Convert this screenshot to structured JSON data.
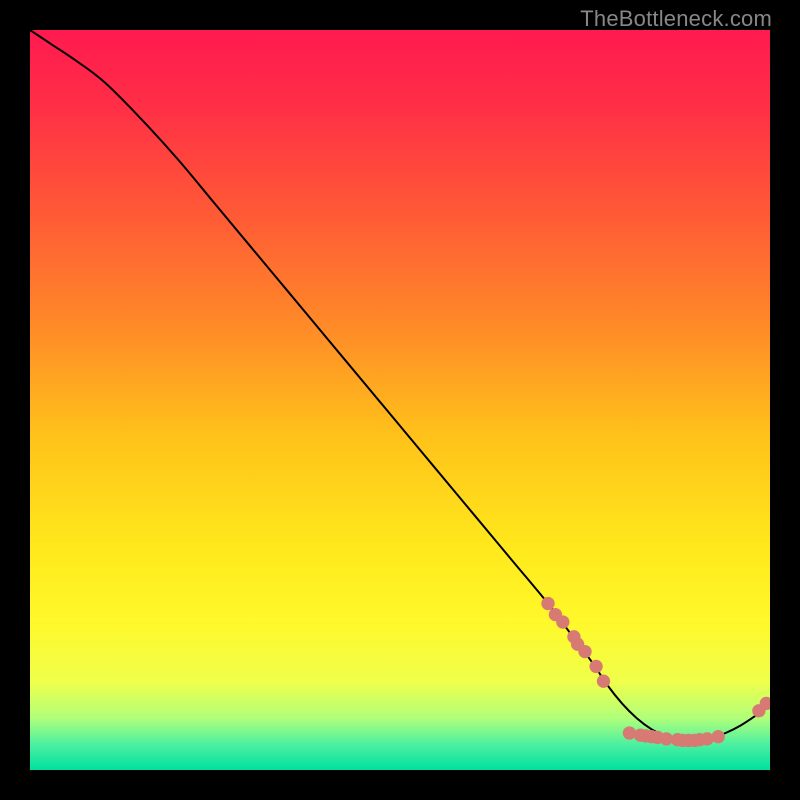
{
  "watermark": "TheBottleneck.com",
  "colors": {
    "marker": "#d87a74",
    "line": "#000000",
    "gradient_stops": [
      {
        "offset": 0.0,
        "color": "#ff1a50"
      },
      {
        "offset": 0.1,
        "color": "#ff2e46"
      },
      {
        "offset": 0.25,
        "color": "#ff5a36"
      },
      {
        "offset": 0.4,
        "color": "#ff8a28"
      },
      {
        "offset": 0.55,
        "color": "#ffc21a"
      },
      {
        "offset": 0.7,
        "color": "#ffe91c"
      },
      {
        "offset": 0.8,
        "color": "#fff82a"
      },
      {
        "offset": 0.88,
        "color": "#f0ff4a"
      },
      {
        "offset": 0.93,
        "color": "#b0ff7a"
      },
      {
        "offset": 0.965,
        "color": "#4df0a0"
      },
      {
        "offset": 1.0,
        "color": "#00e0a0"
      }
    ]
  },
  "chart_data": {
    "type": "line",
    "title": "",
    "xlabel": "",
    "ylabel": "",
    "xlim": [
      0,
      100
    ],
    "ylim": [
      0,
      100
    ],
    "series": [
      {
        "name": "curve",
        "x": [
          0,
          3,
          6,
          10,
          15,
          20,
          25,
          30,
          35,
          40,
          45,
          50,
          55,
          60,
          65,
          70,
          73,
          76,
          78,
          80,
          82,
          84,
          86,
          88,
          90,
          92,
          94,
          96,
          98,
          100
        ],
        "y": [
          100,
          98,
          96,
          93,
          88,
          82.5,
          76.5,
          70.5,
          64.5,
          58.5,
          52.5,
          46.5,
          40.5,
          34.5,
          28.5,
          22.5,
          18.5,
          14.5,
          11.5,
          9.0,
          7.0,
          5.5,
          4.5,
          4.0,
          4.0,
          4.3,
          5.0,
          6.0,
          7.3,
          8.8
        ],
        "stroke": "#000000",
        "stroke_width": 2
      }
    ],
    "markers": [
      {
        "x": 70.0,
        "y": 22.5
      },
      {
        "x": 71.0,
        "y": 21.0
      },
      {
        "x": 72.0,
        "y": 20.0
      },
      {
        "x": 73.5,
        "y": 18.0
      },
      {
        "x": 74.0,
        "y": 17.0
      },
      {
        "x": 75.0,
        "y": 16.0
      },
      {
        "x": 76.5,
        "y": 14.0
      },
      {
        "x": 77.5,
        "y": 12.0
      },
      {
        "x": 81.0,
        "y": 5.0
      },
      {
        "x": 82.5,
        "y": 4.7
      },
      {
        "x": 83.2,
        "y": 4.6
      },
      {
        "x": 84.0,
        "y": 4.5
      },
      {
        "x": 84.8,
        "y": 4.4
      },
      {
        "x": 86.0,
        "y": 4.2
      },
      {
        "x": 87.5,
        "y": 4.1
      },
      {
        "x": 88.2,
        "y": 4.0
      },
      {
        "x": 89.0,
        "y": 4.0
      },
      {
        "x": 89.8,
        "y": 4.0
      },
      {
        "x": 90.5,
        "y": 4.1
      },
      {
        "x": 91.5,
        "y": 4.2
      },
      {
        "x": 93.0,
        "y": 4.5
      },
      {
        "x": 98.5,
        "y": 8.0
      },
      {
        "x": 99.5,
        "y": 9.0
      }
    ],
    "marker_radius_data_units": 0.9,
    "marker_color": "#d87a74"
  }
}
